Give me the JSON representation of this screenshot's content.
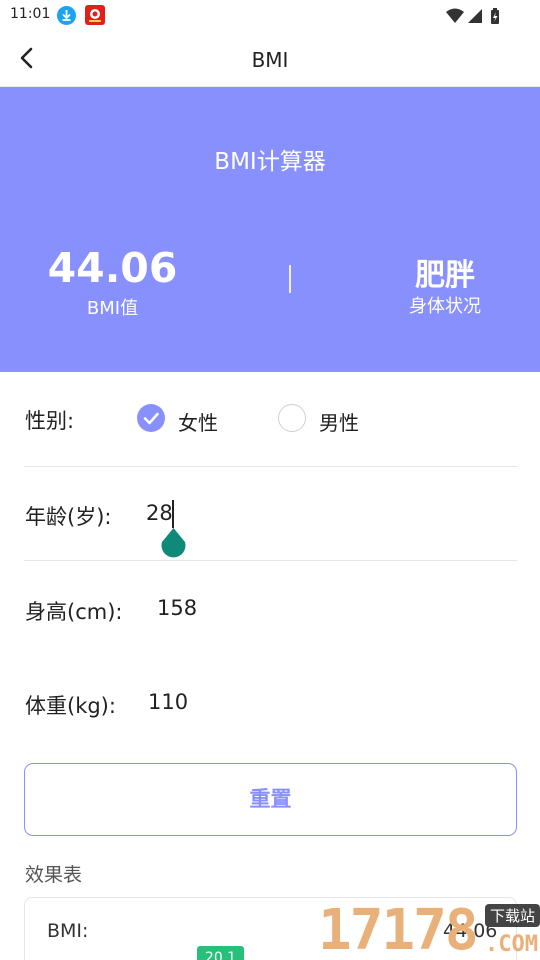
{
  "status_bar": {
    "time": "11:01"
  },
  "app_bar": {
    "title": "BMI"
  },
  "banner": {
    "title": "BMI计算器",
    "bmi_value": "44.06",
    "bmi_label": "BMI值",
    "status_value": "肥胖",
    "status_label": "身体状况"
  },
  "form": {
    "gender_label": "性别:",
    "gender_options": [
      {
        "label": "女性",
        "selected": true
      },
      {
        "label": "男性",
        "selected": false
      }
    ],
    "age_label": "年龄(岁):",
    "age_value": "28",
    "height_label": "身高(cm):",
    "height_value": "158",
    "weight_label": "体重(kg):",
    "weight_value": "110"
  },
  "reset_button": "重置",
  "results": {
    "section_title": "效果表",
    "bmi_label": "BMI:",
    "bmi_value": "44.06",
    "scale_badge": "20.1"
  },
  "watermark": {
    "number": "17178",
    "tag": "下载站",
    "suffix": ".COM"
  },
  "colors": {
    "accent": "#8890fe",
    "handle": "#0f8a7a",
    "badge": "#26c07a"
  }
}
